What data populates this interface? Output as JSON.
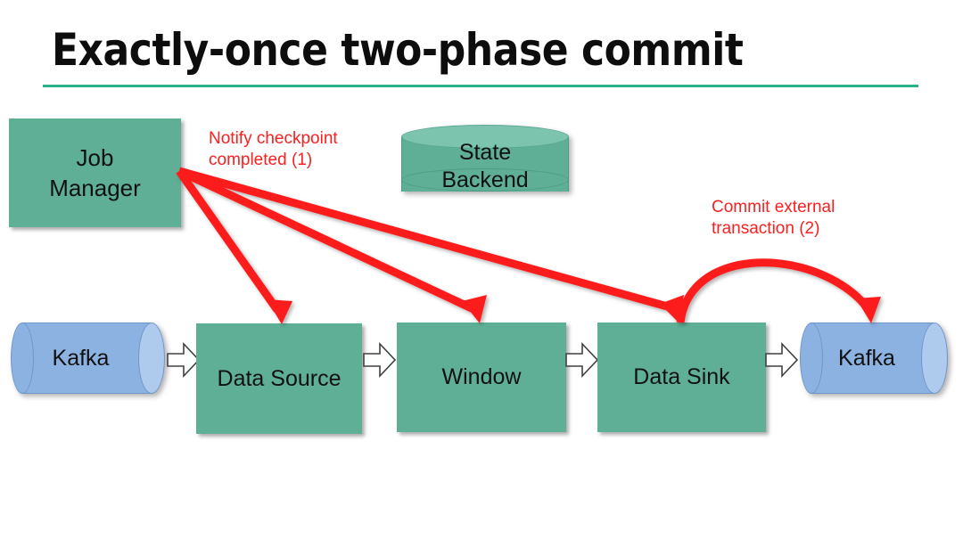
{
  "slide": {
    "title": "Exactly-once two-phase commit",
    "background_color": "#ffffff",
    "rule_color": "#2bb08c"
  },
  "colors": {
    "process_green": "#5eaf96",
    "cylinder_top_green": "#7cc4ae",
    "kafka_blue": "#8cb2e2",
    "kafka_cap_blue": "#aecbee",
    "annotation_red": "#fc1f1f",
    "text_black": "#111111"
  },
  "nodes": {
    "job_manager": {
      "label_line1": "Job",
      "label_line2": "Manager",
      "shape": "rectangle",
      "color": "#5eaf96"
    },
    "state_backend": {
      "label_line1": "State",
      "label_line2": "Backend",
      "shape": "cylinder",
      "color": "#5eaf96"
    },
    "kafka_source": {
      "label": "Kafka",
      "shape": "cylinder",
      "color": "#8cb2e2"
    },
    "data_source": {
      "label": "Data Source",
      "shape": "rectangle",
      "color": "#5eaf96"
    },
    "window": {
      "label": "Window",
      "shape": "rectangle",
      "color": "#5eaf96"
    },
    "data_sink": {
      "label": "Data Sink",
      "shape": "rectangle",
      "color": "#5eaf96"
    },
    "kafka_sink": {
      "label": "Kafka",
      "shape": "cylinder",
      "color": "#8cb2e2"
    }
  },
  "annotations": {
    "notify": {
      "line1": "Notify checkpoint",
      "line2": "completed (1)",
      "color": "#fc1f1f"
    },
    "commit": {
      "line1": "Commit external",
      "line2": "transaction (2)",
      "color": "#fc1f1f"
    }
  },
  "flow_arrows": [
    {
      "from": "kafka_source",
      "to": "data_source",
      "style": "white-block-arrow"
    },
    {
      "from": "data_source",
      "to": "window",
      "style": "white-block-arrow"
    },
    {
      "from": "window",
      "to": "data_sink",
      "style": "white-block-arrow"
    },
    {
      "from": "data_sink",
      "to": "kafka_sink",
      "style": "white-block-arrow"
    }
  ],
  "signal_arrows": [
    {
      "from": "job_manager",
      "to": "data_source",
      "color": "#fc1f1f",
      "style": "straight",
      "label": "notify"
    },
    {
      "from": "job_manager",
      "to": "window",
      "color": "#fc1f1f",
      "style": "straight",
      "label": "notify"
    },
    {
      "from": "job_manager",
      "to": "data_sink",
      "color": "#fc1f1f",
      "style": "straight",
      "label": "notify"
    },
    {
      "from": "data_sink",
      "to": "kafka_sink",
      "color": "#fc1f1f",
      "style": "curved",
      "label": "commit"
    }
  ]
}
